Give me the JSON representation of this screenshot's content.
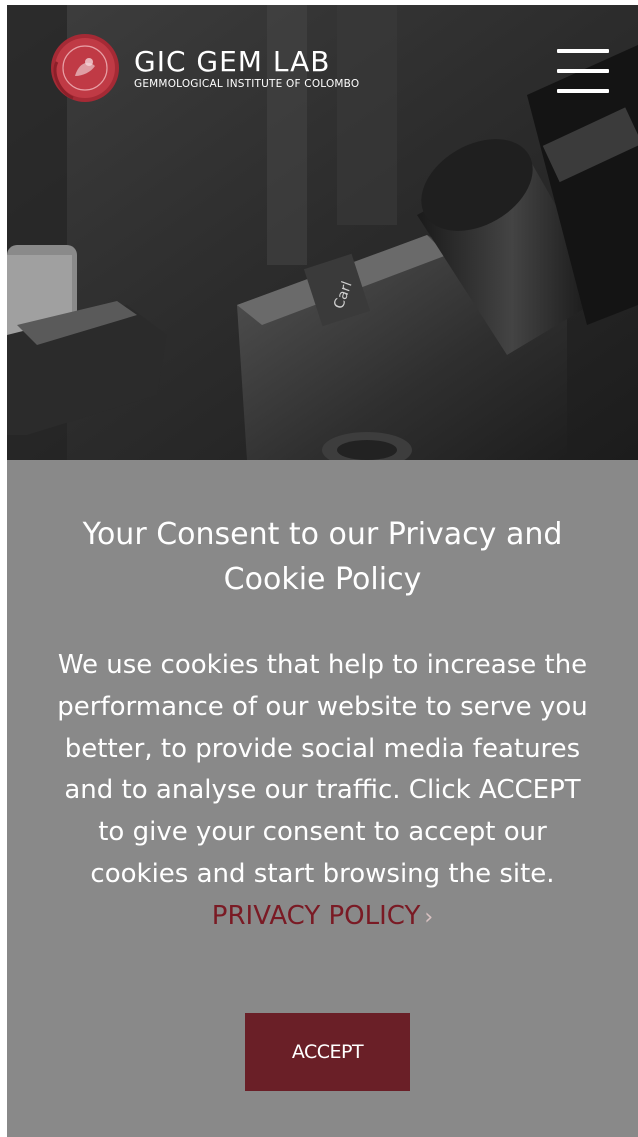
{
  "header": {
    "brand_name": "GIC GEM LAB",
    "brand_subtitle": "GEMMOLOGICAL INSTITUTE OF COLOMBO",
    "logo_icon": "wax-seal-logo-icon",
    "menu_icon": "hamburger-menu-icon"
  },
  "hero": {
    "image": "black-and-white microscope photo"
  },
  "consent": {
    "title": "Your Consent to our Privacy and Cookie Policy",
    "body": "We use cookies that help to increase the performance of our website to serve you better, to provide social media features and to analyse our traffic. Click ACCEPT to give your consent to accept our cookies and start browsing the site.",
    "privacy_link_label": "PRIVACY POLICY",
    "chevron": "›",
    "accept_label": "ACCEPT"
  },
  "colors": {
    "panel_background": "#898989",
    "accent": "#7a1a24",
    "button_background": "#6a1f27",
    "seal_red": "#b8323c"
  }
}
